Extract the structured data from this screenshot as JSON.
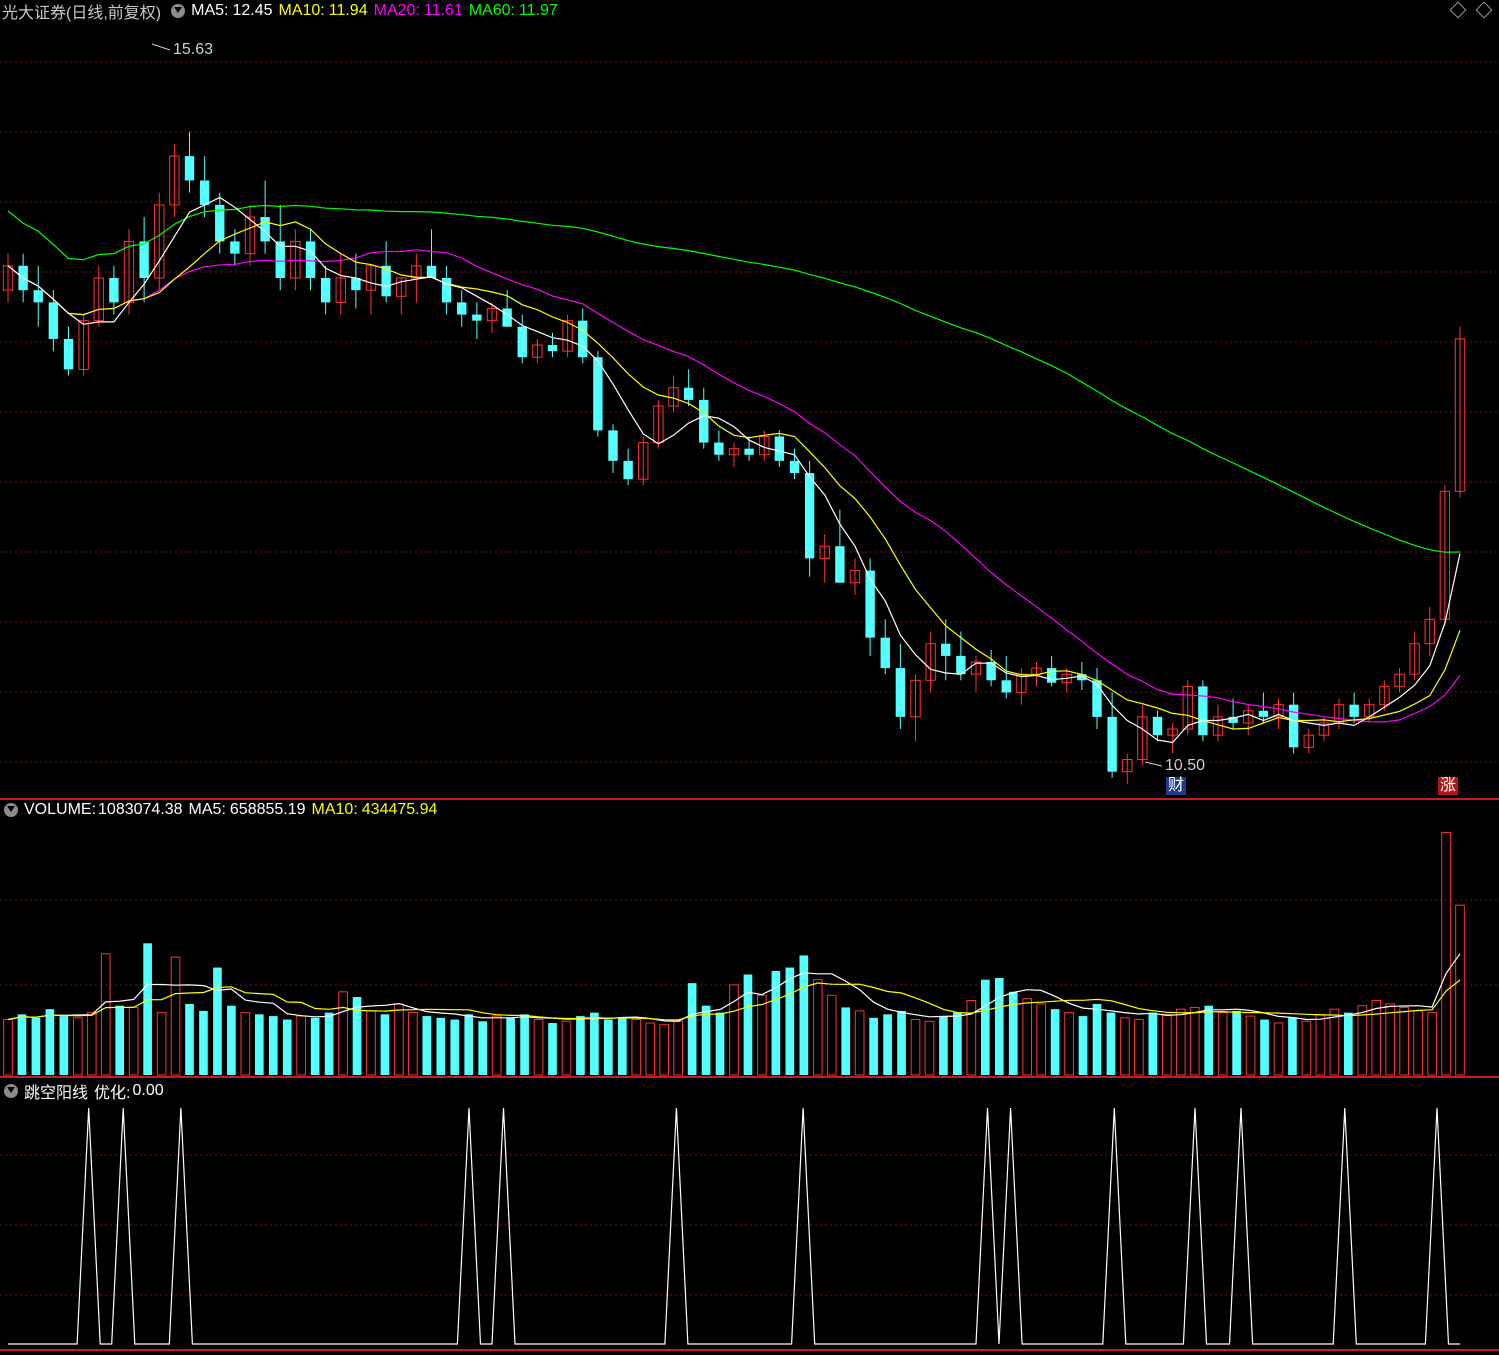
{
  "header": {
    "title": "光大证券(日线,前复权)",
    "ma5_label": "MA5:",
    "ma5_value": "12.45",
    "ma10_label": "MA10:",
    "ma10_value": "11.94",
    "ma20_label": "MA20:",
    "ma20_value": "11.61",
    "ma60_label": "MA60:",
    "ma60_value": "11.97"
  },
  "volume_header": {
    "label": "VOLUME:",
    "value": "1083074.38",
    "ma5_label": "MA5:",
    "ma5_value": "658855.19",
    "ma10_label": "MA10:",
    "ma10_value": "434475.94"
  },
  "indicator_header": {
    "name": "跳空阳线",
    "param_label": "优化:",
    "param_value": "0.00"
  },
  "annotations": {
    "high_label": "15.63",
    "low_label": "10.50",
    "tag_cai": "财",
    "tag_zhang": "涨"
  },
  "colors": {
    "up": "#ff3232",
    "down": "#54ffff",
    "ma5": "#ffffff",
    "ma10": "#ffff00",
    "ma20": "#ff00ff",
    "ma60": "#00ff00",
    "grid": "#7a1010"
  },
  "icons": [
    "collapse-circle-icon",
    "diamond-icon"
  ],
  "chart_data": [
    {
      "type": "candlestick",
      "price_range": [
        10.5,
        15.63
      ],
      "grid": true,
      "series": [
        {
          "name": "MA5"
        },
        {
          "name": "MA10"
        },
        {
          "name": "MA20"
        },
        {
          "name": "MA60"
        }
      ],
      "candles": [
        [
          14.1,
          14.4,
          14.0,
          14.3
        ],
        [
          14.3,
          14.4,
          14.0,
          14.1
        ],
        [
          14.1,
          14.3,
          13.8,
          14.0
        ],
        [
          14.0,
          14.1,
          13.6,
          13.7
        ],
        [
          13.7,
          13.8,
          13.4,
          13.45
        ],
        [
          13.45,
          13.9,
          13.4,
          13.85
        ],
        [
          13.85,
          14.3,
          13.8,
          14.2
        ],
        [
          14.2,
          14.3,
          13.9,
          14.0
        ],
        [
          14.0,
          14.6,
          13.9,
          14.5
        ],
        [
          14.5,
          14.7,
          14.0,
          14.2
        ],
        [
          14.2,
          14.9,
          14.1,
          14.8
        ],
        [
          14.8,
          15.3,
          14.7,
          15.2
        ],
        [
          15.2,
          15.4,
          14.9,
          15.0
        ],
        [
          15.0,
          15.2,
          14.7,
          14.8
        ],
        [
          14.8,
          14.9,
          14.4,
          14.5
        ],
        [
          14.5,
          14.6,
          14.3,
          14.4
        ],
        [
          14.4,
          14.8,
          14.3,
          14.7
        ],
        [
          14.7,
          15.0,
          14.4,
          14.5
        ],
        [
          14.5,
          14.8,
          14.1,
          14.2
        ],
        [
          14.2,
          14.6,
          14.1,
          14.5
        ],
        [
          14.5,
          14.6,
          14.1,
          14.2
        ],
        [
          14.2,
          14.3,
          13.9,
          14.0
        ],
        [
          14.0,
          14.4,
          13.9,
          14.2
        ],
        [
          14.2,
          14.4,
          13.95,
          14.1
        ],
        [
          14.1,
          14.3,
          13.9,
          14.3
        ],
        [
          14.3,
          14.5,
          14.0,
          14.05
        ],
        [
          14.05,
          14.2,
          13.9,
          14.2
        ],
        [
          14.2,
          14.4,
          14.0,
          14.3
        ],
        [
          14.3,
          14.6,
          14.2,
          14.2
        ],
        [
          14.2,
          14.3,
          13.9,
          14.0
        ],
        [
          14.0,
          14.1,
          13.8,
          13.9
        ],
        [
          13.9,
          14.0,
          13.7,
          13.85
        ],
        [
          13.85,
          14.0,
          13.75,
          13.95
        ],
        [
          13.95,
          14.1,
          13.8,
          13.8
        ],
        [
          13.8,
          13.9,
          13.5,
          13.55
        ],
        [
          13.55,
          13.7,
          13.5,
          13.65
        ],
        [
          13.65,
          13.75,
          13.55,
          13.6
        ],
        [
          13.6,
          13.9,
          13.55,
          13.85
        ],
        [
          13.85,
          13.95,
          13.5,
          13.55
        ],
        [
          13.55,
          13.6,
          12.9,
          12.95
        ],
        [
          12.95,
          13.0,
          12.6,
          12.7
        ],
        [
          12.7,
          12.8,
          12.5,
          12.55
        ],
        [
          12.55,
          12.9,
          12.5,
          12.85
        ],
        [
          12.85,
          13.2,
          12.8,
          13.15
        ],
        [
          13.15,
          13.4,
          13.1,
          13.3
        ],
        [
          13.3,
          13.45,
          13.15,
          13.2
        ],
        [
          13.2,
          13.3,
          12.8,
          12.85
        ],
        [
          12.85,
          12.95,
          12.7,
          12.75
        ],
        [
          12.75,
          12.85,
          12.65,
          12.8
        ],
        [
          12.8,
          12.9,
          12.7,
          12.75
        ],
        [
          12.75,
          12.95,
          12.7,
          12.9
        ],
        [
          12.9,
          12.95,
          12.65,
          12.7
        ],
        [
          12.7,
          12.8,
          12.55,
          12.6
        ],
        [
          12.6,
          12.7,
          11.75,
          11.9
        ],
        [
          11.9,
          12.1,
          11.7,
          12.0
        ],
        [
          12.0,
          12.3,
          11.9,
          11.7
        ],
        [
          11.7,
          11.9,
          11.6,
          11.8
        ],
        [
          11.8,
          11.9,
          11.1,
          11.25
        ],
        [
          11.25,
          11.4,
          10.95,
          11.0
        ],
        [
          11.0,
          11.2,
          10.5,
          10.6
        ],
        [
          10.6,
          10.95,
          10.4,
          10.9
        ],
        [
          10.9,
          11.3,
          10.8,
          11.2
        ],
        [
          11.2,
          11.4,
          10.9,
          11.1
        ],
        [
          11.1,
          11.3,
          10.9,
          10.95
        ],
        [
          10.95,
          11.1,
          10.8,
          11.05
        ],
        [
          11.05,
          11.15,
          10.85,
          10.9
        ],
        [
          10.9,
          11.1,
          10.75,
          10.8
        ],
        [
          10.8,
          11.0,
          10.7,
          10.95
        ],
        [
          10.95,
          11.05,
          10.85,
          11.0
        ],
        [
          11.0,
          11.1,
          10.85,
          10.88
        ],
        [
          10.88,
          11.0,
          10.8,
          10.95
        ],
        [
          10.95,
          11.05,
          10.82,
          10.9
        ],
        [
          10.9,
          11.0,
          10.5,
          10.6
        ],
        [
          10.6,
          10.8,
          10.1,
          10.15
        ],
        [
          10.15,
          10.3,
          10.05,
          10.25
        ],
        [
          10.25,
          10.7,
          10.2,
          10.6
        ],
        [
          10.6,
          10.65,
          10.4,
          10.45
        ],
        [
          10.45,
          10.55,
          10.3,
          10.5
        ],
        [
          10.5,
          10.9,
          10.45,
          10.85
        ],
        [
          10.85,
          10.9,
          10.4,
          10.45
        ],
        [
          10.45,
          10.7,
          10.4,
          10.6
        ],
        [
          10.6,
          10.75,
          10.5,
          10.55
        ],
        [
          10.55,
          10.7,
          10.45,
          10.65
        ],
        [
          10.65,
          10.8,
          10.55,
          10.6
        ],
        [
          10.6,
          10.75,
          10.5,
          10.7
        ],
        [
          10.7,
          10.8,
          10.3,
          10.35
        ],
        [
          10.35,
          10.5,
          10.3,
          10.45
        ],
        [
          10.45,
          10.6,
          10.4,
          10.55
        ],
        [
          10.55,
          10.75,
          10.5,
          10.7
        ],
        [
          10.7,
          10.8,
          10.55,
          10.6
        ],
        [
          10.6,
          10.75,
          10.55,
          10.7
        ],
        [
          10.7,
          10.9,
          10.65,
          10.85
        ],
        [
          10.85,
          11.0,
          10.8,
          10.95
        ],
        [
          10.95,
          11.3,
          10.9,
          11.2
        ],
        [
          11.2,
          11.5,
          11.1,
          11.4
        ],
        [
          11.4,
          12.5,
          11.35,
          12.45
        ],
        [
          12.45,
          13.8,
          12.4,
          13.7
        ]
      ]
    },
    {
      "type": "bar",
      "title": "VOLUME",
      "values": [
        3.2,
        3.5,
        3.3,
        3.8,
        3.4,
        3.3,
        3.6,
        7.0,
        4.0,
        3.9,
        7.6,
        3.6,
        6.8,
        4.1,
        3.7,
        6.2,
        4.0,
        3.6,
        3.5,
        3.4,
        3.2,
        3.4,
        3.3,
        3.6,
        4.8,
        4.5,
        3.7,
        3.5,
        4.1,
        3.6,
        3.4,
        3.3,
        3.2,
        3.5,
        3.1,
        3.4,
        3.3,
        3.5,
        3.2,
        3.0,
        3.1,
        3.4,
        3.6,
        3.2,
        3.3,
        3.2,
        3.0,
        2.9,
        3.1,
        5.3,
        4.0,
        3.6,
        5.2,
        5.8,
        4.6,
        6.0,
        6.2,
        6.9,
        5.5,
        4.6,
        3.9,
        3.7,
        3.3,
        3.5,
        3.7,
        3.2,
        3.1,
        3.4,
        3.6,
        4.3,
        5.5,
        5.6,
        4.8,
        4.4,
        4.1,
        3.8,
        3.6,
        3.4,
        4.1,
        3.6,
        3.3,
        3.2,
        3.6,
        3.5,
        3.8,
        3.9,
        4.0,
        3.6,
        3.7,
        3.4,
        3.2,
        3.0,
        3.3,
        3.1,
        3.5,
        3.8,
        3.6,
        4.0,
        4.3,
        4.1,
        3.9,
        3.7,
        3.6,
        14.0,
        9.8
      ]
    },
    {
      "type": "line",
      "title": "跳空阳线",
      "values": [
        0,
        0,
        0,
        0,
        0,
        0,
        0,
        1,
        0,
        0,
        1,
        0,
        0,
        0,
        0,
        1,
        0,
        0,
        0,
        0,
        0,
        0,
        0,
        0,
        0,
        0,
        0,
        0,
        0,
        0,
        0,
        0,
        0,
        0,
        0,
        0,
        0,
        0,
        0,
        0,
        1,
        0,
        0,
        1,
        0,
        0,
        0,
        0,
        0,
        0,
        0,
        0,
        0,
        0,
        0,
        0,
        0,
        0,
        1,
        0,
        0,
        0,
        0,
        0,
        0,
        0,
        0,
        0,
        0,
        1,
        0,
        0,
        0,
        0,
        0,
        0,
        0,
        0,
        0,
        0,
        0,
        0,
        0,
        0,
        0,
        1,
        0,
        1,
        0,
        0,
        0,
        0,
        0,
        0,
        0,
        0,
        1,
        0,
        0,
        0,
        0,
        0,
        0,
        1,
        0,
        0,
        0,
        1,
        0,
        0,
        0,
        0,
        0,
        0,
        0,
        0,
        1,
        0,
        0,
        0,
        0,
        0,
        0,
        0,
        1,
        0,
        0
      ]
    }
  ]
}
